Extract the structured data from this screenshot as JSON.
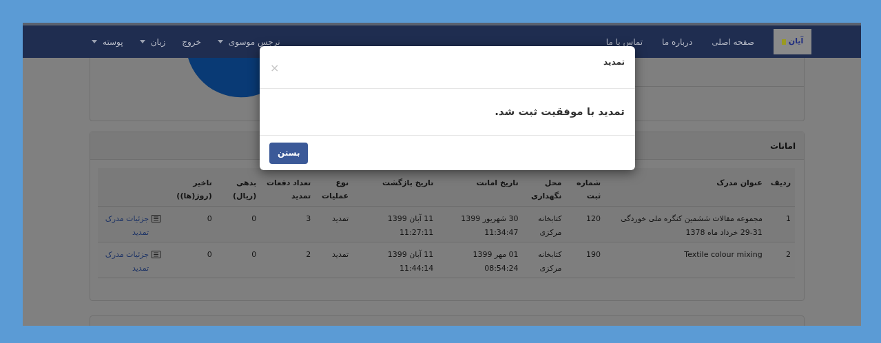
{
  "navbar": {
    "logo_text": "آیان",
    "links": [
      "صفحه اصلی",
      "درباره ما",
      "تماس با ما"
    ],
    "menus": [
      {
        "label": "نرجس موسوی",
        "dropdown": true
      },
      {
        "label": "خروج",
        "dropdown": false
      },
      {
        "label": "زبان",
        "dropdown": true
      },
      {
        "label": "پوسته",
        "dropdown": true
      }
    ]
  },
  "loans_panel": {
    "title": "امانات",
    "table": {
      "columns": [
        "ردیف",
        "عنوان مدرک",
        "شماره ثبت",
        "محل نگهداری",
        "تاریخ امانت",
        "تاریخ بازگشت",
        "نوع عملیات",
        "تعداد دفعات تمدید",
        "بدهی (ریال)",
        "تاخیر (روز(ها))",
        ""
      ],
      "rows": [
        {
          "cells": [
            "1",
            "مجموعه مقالات ششمین کنگره ملی خوردگی 31-29 خرداد ماه 1378",
            "120",
            "کتابخانه مرکزی",
            "30 شهریور 1399 11:34:47",
            "11 آبان 1399 11:27:11",
            "تمدید",
            "3",
            "0",
            "0"
          ],
          "link": "جزئیات مدرک تمدید"
        },
        {
          "cells": [
            "2",
            "Textile colour mixing",
            "190",
            "کتابخانه مرکزی",
            "01 مهر 1399 08:54:24",
            "11 آبان 1399 11:44:14",
            "تمدید",
            "2",
            "0",
            "0"
          ],
          "link": "جزئیات مدرک تمدید"
        }
      ]
    }
  },
  "modal": {
    "title": "تمدید",
    "close_symbol": "×",
    "message": "تمدید با موفقیت ثبت شد.",
    "button": "بستن"
  }
}
